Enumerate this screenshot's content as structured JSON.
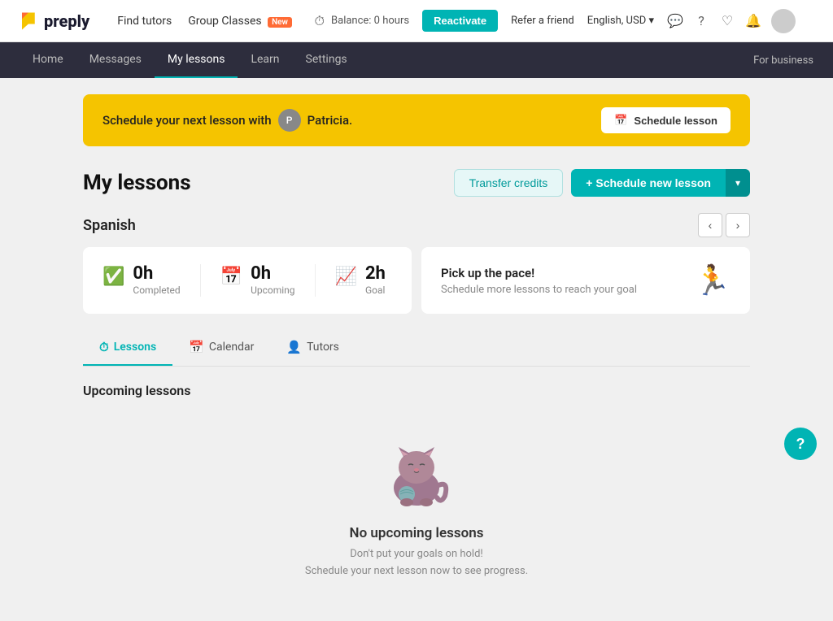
{
  "topNav": {
    "logoText": "preply",
    "links": [
      {
        "label": "Find tutors",
        "id": "find-tutors"
      },
      {
        "label": "Group Classes",
        "id": "group-classes"
      },
      {
        "badge": "New"
      }
    ],
    "balance": "Balance: 0 hours",
    "reactivateBtn": "Reactivate",
    "referLink": "Refer a friend",
    "langSelect": "English, USD",
    "forBusiness": "For business"
  },
  "secondaryNav": {
    "items": [
      {
        "label": "Home",
        "active": false
      },
      {
        "label": "Messages",
        "active": false
      },
      {
        "label": "My lessons",
        "active": true
      },
      {
        "label": "Learn",
        "active": false
      },
      {
        "label": "Settings",
        "active": false
      }
    ]
  },
  "banner": {
    "text1": "Schedule your next lesson with",
    "tutorName": "Patricia.",
    "btnLabel": "Schedule lesson"
  },
  "myLessons": {
    "title": "My lessons",
    "transferBtn": "Transfer credits",
    "scheduleBtn": "+ Schedule new lesson"
  },
  "spanish": {
    "title": "Spanish",
    "stats": {
      "completed": {
        "value": "0h",
        "label": "Completed"
      },
      "upcoming": {
        "value": "0h",
        "label": "Upcoming"
      },
      "goal": {
        "value": "2h",
        "label": "Goal"
      }
    },
    "pace": {
      "title": "Pick up the pace!",
      "subtitle": "Schedule more lessons to reach your goal"
    }
  },
  "tabs": [
    {
      "label": "Lessons",
      "active": true,
      "icon": "clock"
    },
    {
      "label": "Calendar",
      "active": false,
      "icon": "calendar"
    },
    {
      "label": "Tutors",
      "active": false,
      "icon": "person"
    }
  ],
  "upcoming": {
    "sectionTitle": "Upcoming lessons",
    "emptyTitle": "No upcoming lessons",
    "emptyLine1": "Don't put your goals on hold!",
    "emptyLine2": "Schedule your next lesson now to see progress."
  },
  "helpBtn": "?"
}
